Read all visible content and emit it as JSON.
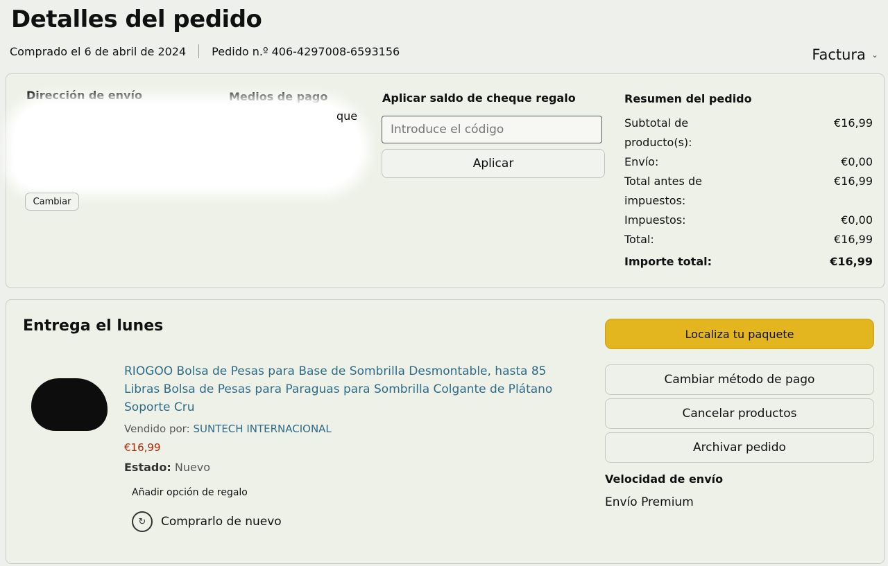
{
  "page": {
    "title": "Detalles del pedido",
    "purchase_date": "Comprado el 6 de abril de 2024",
    "order_number": "Pedido n.º 406-4297008-6593156",
    "invoice_label": "Factura"
  },
  "shipping": {
    "header": "Dirección de envío",
    "change_label": "Cambiar"
  },
  "payment": {
    "header": "Medios de pago",
    "visible_suffix": "que"
  },
  "gift_card": {
    "header": "Aplicar saldo de cheque regalo",
    "placeholder": "Introduce el código",
    "apply_label": "Aplicar"
  },
  "summary": {
    "header": "Resumen del pedido",
    "rows": [
      {
        "label": "Subtotal de producto(s):",
        "value": "€16,99"
      },
      {
        "label": "Envío:",
        "value": "€0,00"
      },
      {
        "label": "Total antes de impuestos:",
        "value": "€16,99"
      },
      {
        "label": "Impuestos:",
        "value": "€0,00"
      },
      {
        "label": "Total:",
        "value": "€16,99"
      }
    ],
    "grand_total_label": "Importe total:",
    "grand_total_value": "€16,99"
  },
  "delivery": {
    "title": "Entrega el lunes",
    "product_title": "RIOGOO Bolsa de Pesas para Base de Sombrilla Desmontable, hasta 85 Libras Bolsa de Pesas para Paraguas para Sombrilla Colgante de Plátano Soporte Cru",
    "sold_by_label": "Vendido por:",
    "seller": "SUNTECH INTERNACIONAL",
    "price": "€16,99",
    "condition_label": "Estado:",
    "condition_value": "Nuevo",
    "gift_option": "Añadir opción de regalo",
    "buy_again": "Comprarlo de nuevo"
  },
  "actions": {
    "track": "Localiza tu paquete",
    "change_payment": "Cambiar método de pago",
    "cancel": "Cancelar productos",
    "archive": "Archivar pedido"
  },
  "shipping_speed": {
    "label": "Velocidad de envío",
    "value": "Envío Premium"
  },
  "colors": {
    "accent_button": "#e3b51e",
    "link": "#2d6b87",
    "price": "#b12704"
  }
}
